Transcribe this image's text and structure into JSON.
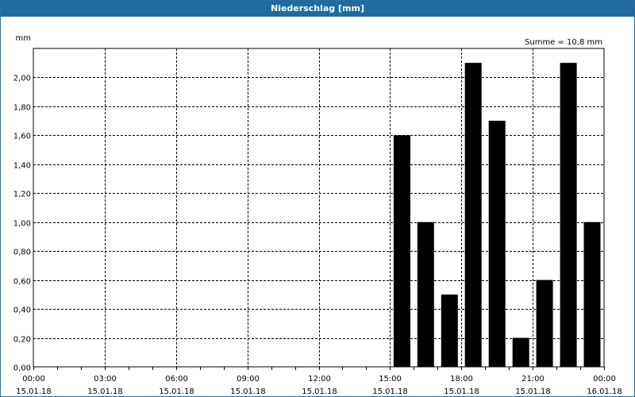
{
  "window": {
    "title": "Niederschlag [mm]"
  },
  "colors": {
    "titlebar_bg": "#1f6aa3",
    "bar_fill": "#000000",
    "grid": "#000000",
    "background": "#ffffff"
  },
  "chart_data": {
    "type": "bar",
    "ylabel": "mm",
    "annotation": "Summe = 10,8 mm",
    "ylim": [
      0,
      2.2
    ],
    "y_ticks": [
      "0,00",
      "0,20",
      "0,40",
      "0,60",
      "0,80",
      "1,00",
      "1,20",
      "1,40",
      "1,60",
      "1,80",
      "2,00"
    ],
    "x_ticks": [
      {
        "time": "00:00",
        "date": "15.01.18"
      },
      {
        "time": "03:00",
        "date": "15.01.18"
      },
      {
        "time": "06:00",
        "date": "15.01.18"
      },
      {
        "time": "09:00",
        "date": "15.01.18"
      },
      {
        "time": "12:00",
        "date": "15.01.18"
      },
      {
        "time": "15:00",
        "date": "15.01.18"
      },
      {
        "time": "18:00",
        "date": "15.01.18"
      },
      {
        "time": "21:00",
        "date": "15.01.18"
      },
      {
        "time": "00:00",
        "date": "16.01.18"
      }
    ],
    "categories": [
      "15:00",
      "16:00",
      "17:00",
      "18:00",
      "19:00",
      "20:00",
      "21:00",
      "22:00",
      "23:00"
    ],
    "values": [
      1.6,
      1.0,
      0.5,
      2.1,
      1.7,
      0.2,
      0.6,
      2.1,
      1.0
    ],
    "grid": true,
    "legend": "none"
  }
}
